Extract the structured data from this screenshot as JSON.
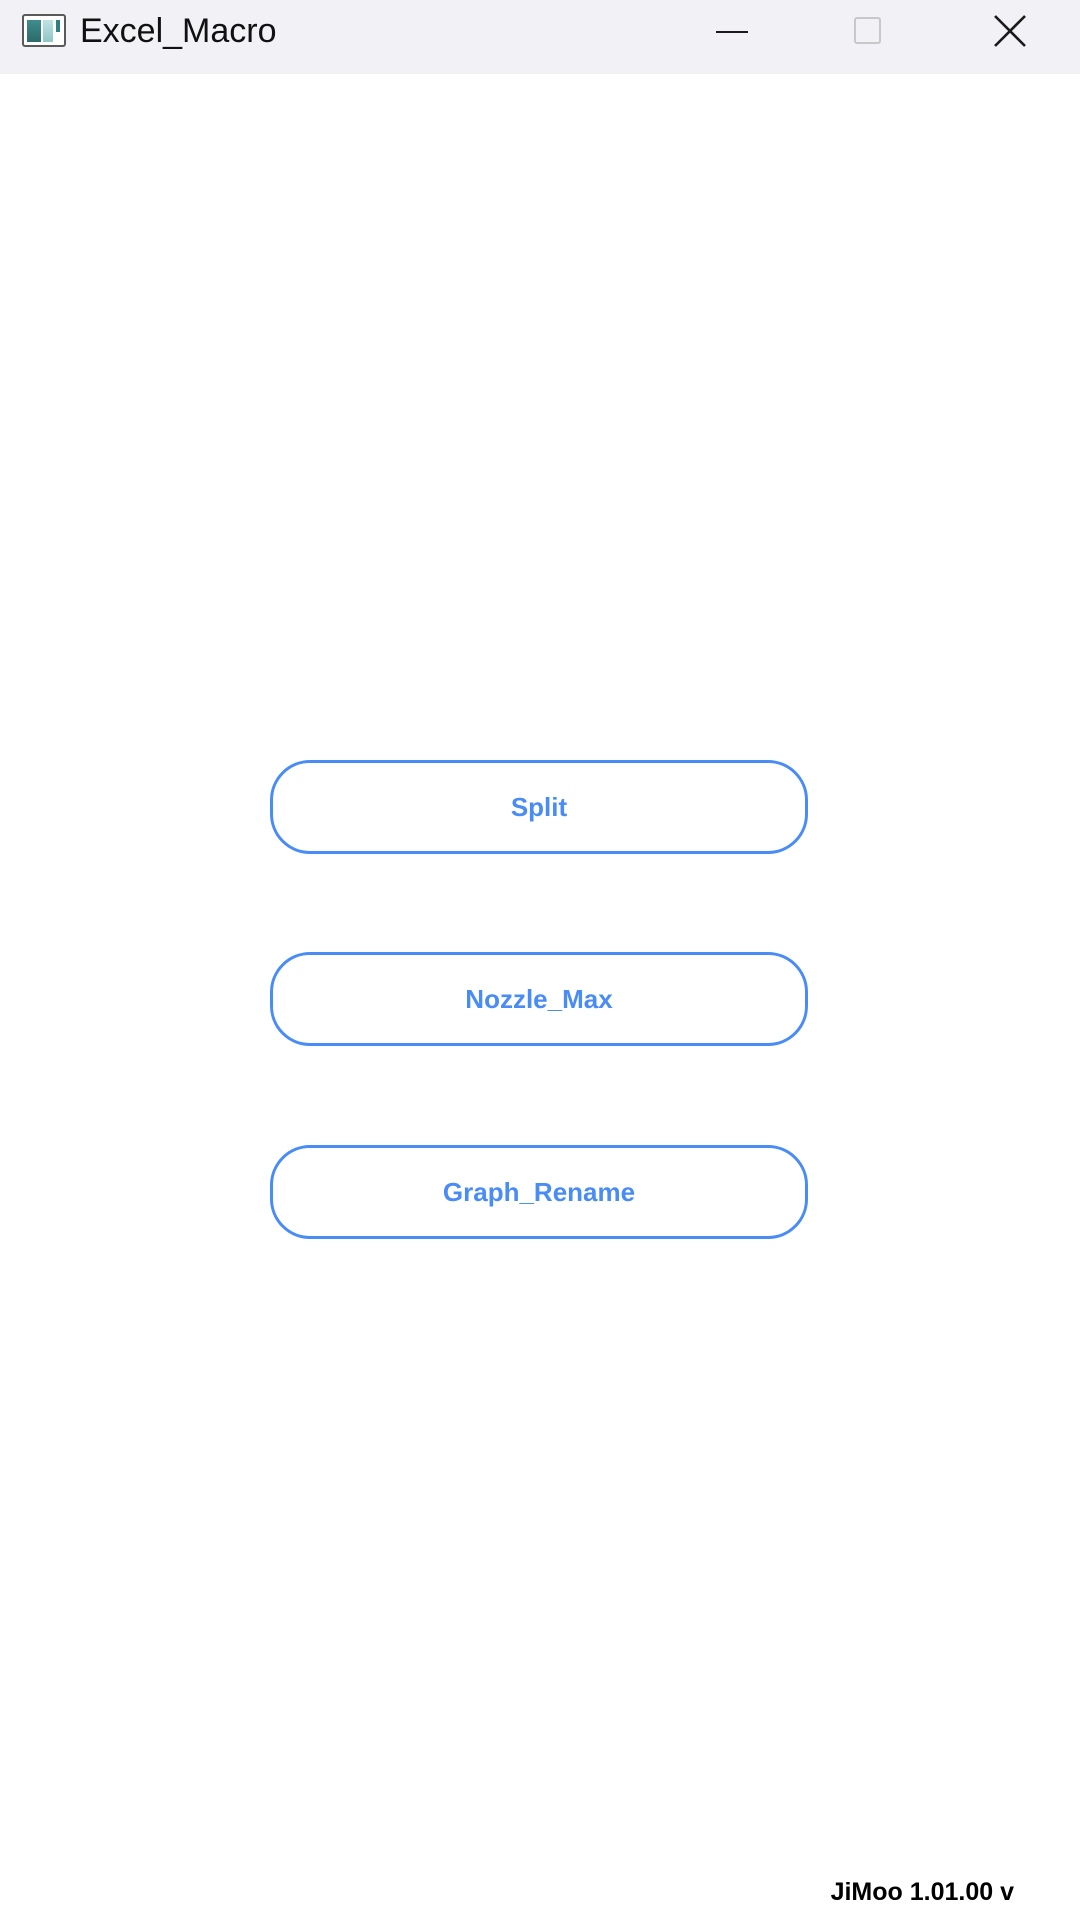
{
  "window": {
    "title": "Excel_Macro",
    "app_icon": "app-window-icon",
    "controls": {
      "minimize_icon": "minimize-icon",
      "maximize_icon": "maximize-icon",
      "close_icon": "close-icon"
    }
  },
  "buttons": {
    "split": "Split",
    "nozzle_max": "Nozzle_Max",
    "graph_rename": "Graph_Rename"
  },
  "footer": {
    "version": "JiMoo 1.01.00 v"
  },
  "colors": {
    "accent": "#4a8cf5",
    "titlebar_bg": "#f2f1f6",
    "window_bg": "#ffffff"
  }
}
